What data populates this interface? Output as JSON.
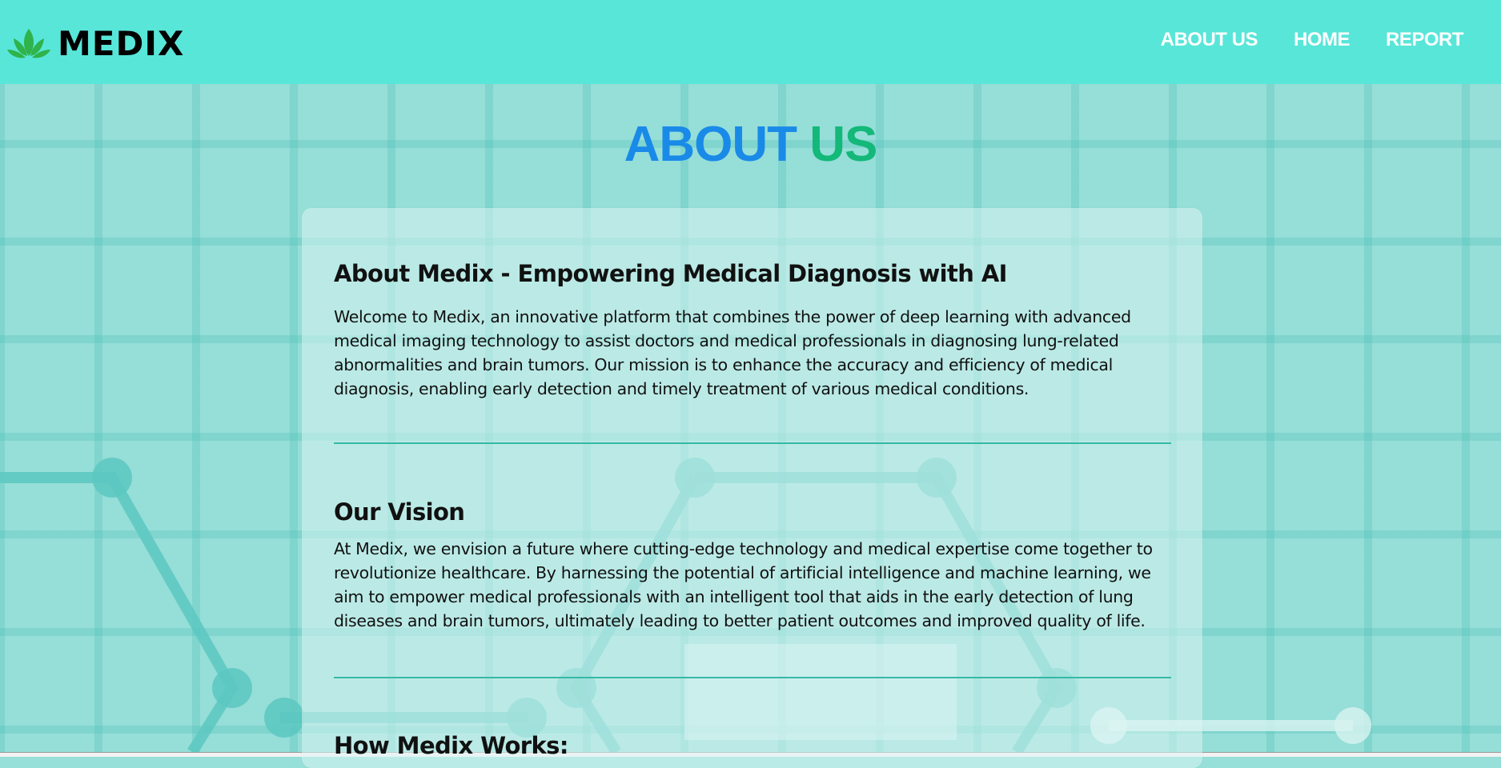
{
  "brand": {
    "name": "MEDIX",
    "icon": "lotus-leaf-icon",
    "icon_color": "#2fb34a"
  },
  "nav": {
    "items": [
      "ABOUT US",
      "HOME",
      "REPORT"
    ]
  },
  "page": {
    "title_part1": "ABOUT",
    "title_part2": "US"
  },
  "sections": [
    {
      "heading": "About Medix - Empowering Medical Diagnosis with AI",
      "body": "Welcome to Medix, an innovative platform that combines the power of deep learning with advanced medical imaging technology to assist doctors and medical professionals in diagnosing lung-related abnormalities and brain tumors. Our mission is to enhance the accuracy and efficiency of medical diagnosis, enabling early detection and timely treatment of various medical conditions."
    },
    {
      "heading": "Our Vision",
      "body": "At Medix, we envision a future where cutting-edge technology and medical expertise come together to revolutionize healthcare. By harnessing the potential of artificial intelligence and machine learning, we aim to empower medical professionals with an intelligent tool that aids in the early detection of lung diseases and brain tumors, ultimately leading to better patient outcomes and improved quality of life."
    },
    {
      "heading": "How Medix Works:"
    }
  ],
  "colors": {
    "header": "#58e6d9",
    "title_blue": "#1a8ae8",
    "title_green": "#14b879",
    "divider": "#36b8a6"
  }
}
